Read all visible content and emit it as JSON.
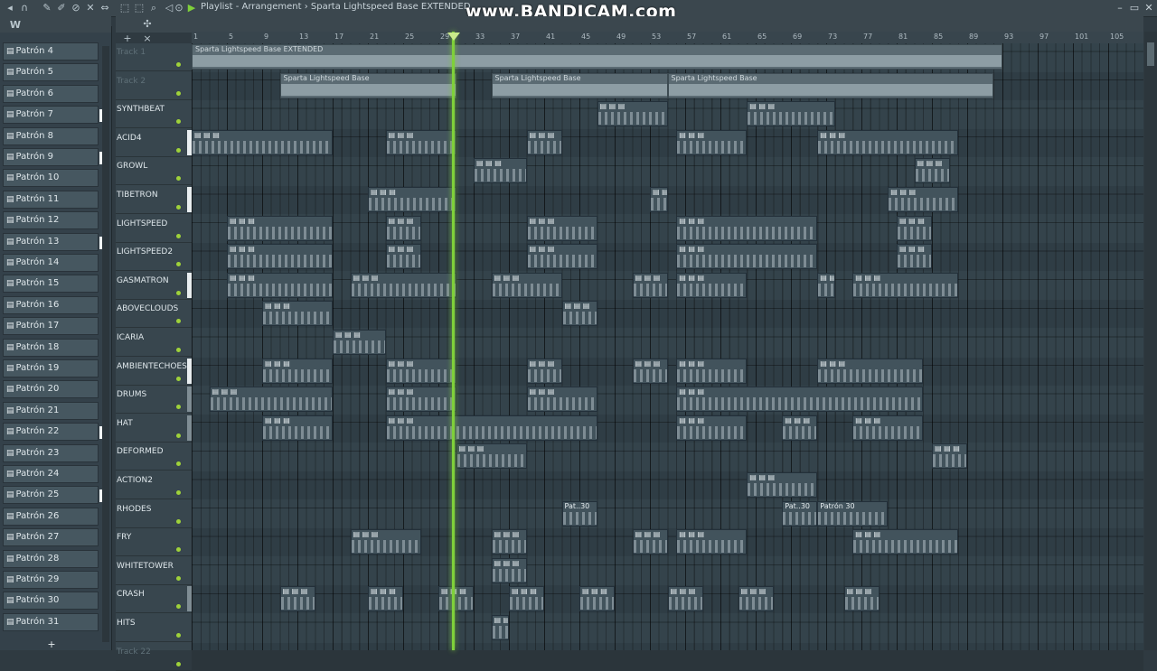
{
  "window": {
    "title": "Playlist - Arrangement › Sparta Lightspeed Base EXTENDED",
    "watermark": "www.BANDICAM.com",
    "minimize": "–",
    "maximize": "▭",
    "close": "✕"
  },
  "toolbar": {
    "icons": [
      "magnet-icon",
      "pencil-icon",
      "brush-icon",
      "delete-icon",
      "mute-icon",
      "slip-icon",
      "select-icon",
      "zoom-icon",
      "playback-icon"
    ]
  },
  "picker": {
    "items": [
      {
        "label": "Patrón 4"
      },
      {
        "label": "Patrón 5"
      },
      {
        "label": "Patrón 6"
      },
      {
        "label": "Patrón 7"
      },
      {
        "label": "Patrón 8"
      },
      {
        "label": "Patrón 9"
      },
      {
        "label": "Patrón 10"
      },
      {
        "label": "Patrón 11"
      },
      {
        "label": "Patrón 12"
      },
      {
        "label": "Patrón 13"
      },
      {
        "label": "Patrón 14"
      },
      {
        "label": "Patrón 15"
      },
      {
        "label": "Patrón 16"
      },
      {
        "label": "Patrón 17"
      },
      {
        "label": "Patrón 18"
      },
      {
        "label": "Patrón 19"
      },
      {
        "label": "Patrón 20"
      },
      {
        "label": "Patrón 21"
      },
      {
        "label": "Patrón 22"
      },
      {
        "label": "Patrón 23"
      },
      {
        "label": "Patrón 24"
      },
      {
        "label": "Patrón 25"
      },
      {
        "label": "Patrón 26"
      },
      {
        "label": "Patrón 27"
      },
      {
        "label": "Patrón 28"
      },
      {
        "label": "Patrón 29"
      },
      {
        "label": "Patrón 30"
      },
      {
        "label": "Patrón 31"
      }
    ],
    "add_label": "+"
  },
  "ruler": {
    "bars": [
      "1",
      "5",
      "9",
      "13",
      "17",
      "21",
      "25",
      "29",
      "33",
      "37",
      "41",
      "45",
      "49",
      "53",
      "57",
      "61",
      "65",
      "69",
      "73",
      "77",
      "81",
      "85",
      "89",
      "93",
      "97",
      "101",
      "105"
    ]
  },
  "tracks": [
    {
      "name": "Track 1"
    },
    {
      "name": "Track 2"
    },
    {
      "name": "SYNTHBEAT"
    },
    {
      "name": "ACID4"
    },
    {
      "name": "GROWL"
    },
    {
      "name": "TIBETRON"
    },
    {
      "name": "LIGHTSPEED"
    },
    {
      "name": "LIGHTSPEED2"
    },
    {
      "name": "GASMATRON"
    },
    {
      "name": "ABOVECLOUDS"
    },
    {
      "name": "ICARIA"
    },
    {
      "name": "AMBIENTECHOES"
    },
    {
      "name": "DRUMS"
    },
    {
      "name": "HAT"
    },
    {
      "name": "DEFORMED"
    },
    {
      "name": "ACTION2"
    },
    {
      "name": "RHODES"
    },
    {
      "name": "FRY"
    },
    {
      "name": "WHITETOWER"
    },
    {
      "name": "CRASH"
    },
    {
      "name": "HITS"
    },
    {
      "name": "Track 22"
    }
  ],
  "audio_clips": {
    "main": "Sparta Lightspeed Base EXTENDED",
    "sub": "Sparta Lightspeed Base"
  },
  "rhodes_clips": {
    "short": "Pat..30",
    "long": "Patrón 30"
  }
}
